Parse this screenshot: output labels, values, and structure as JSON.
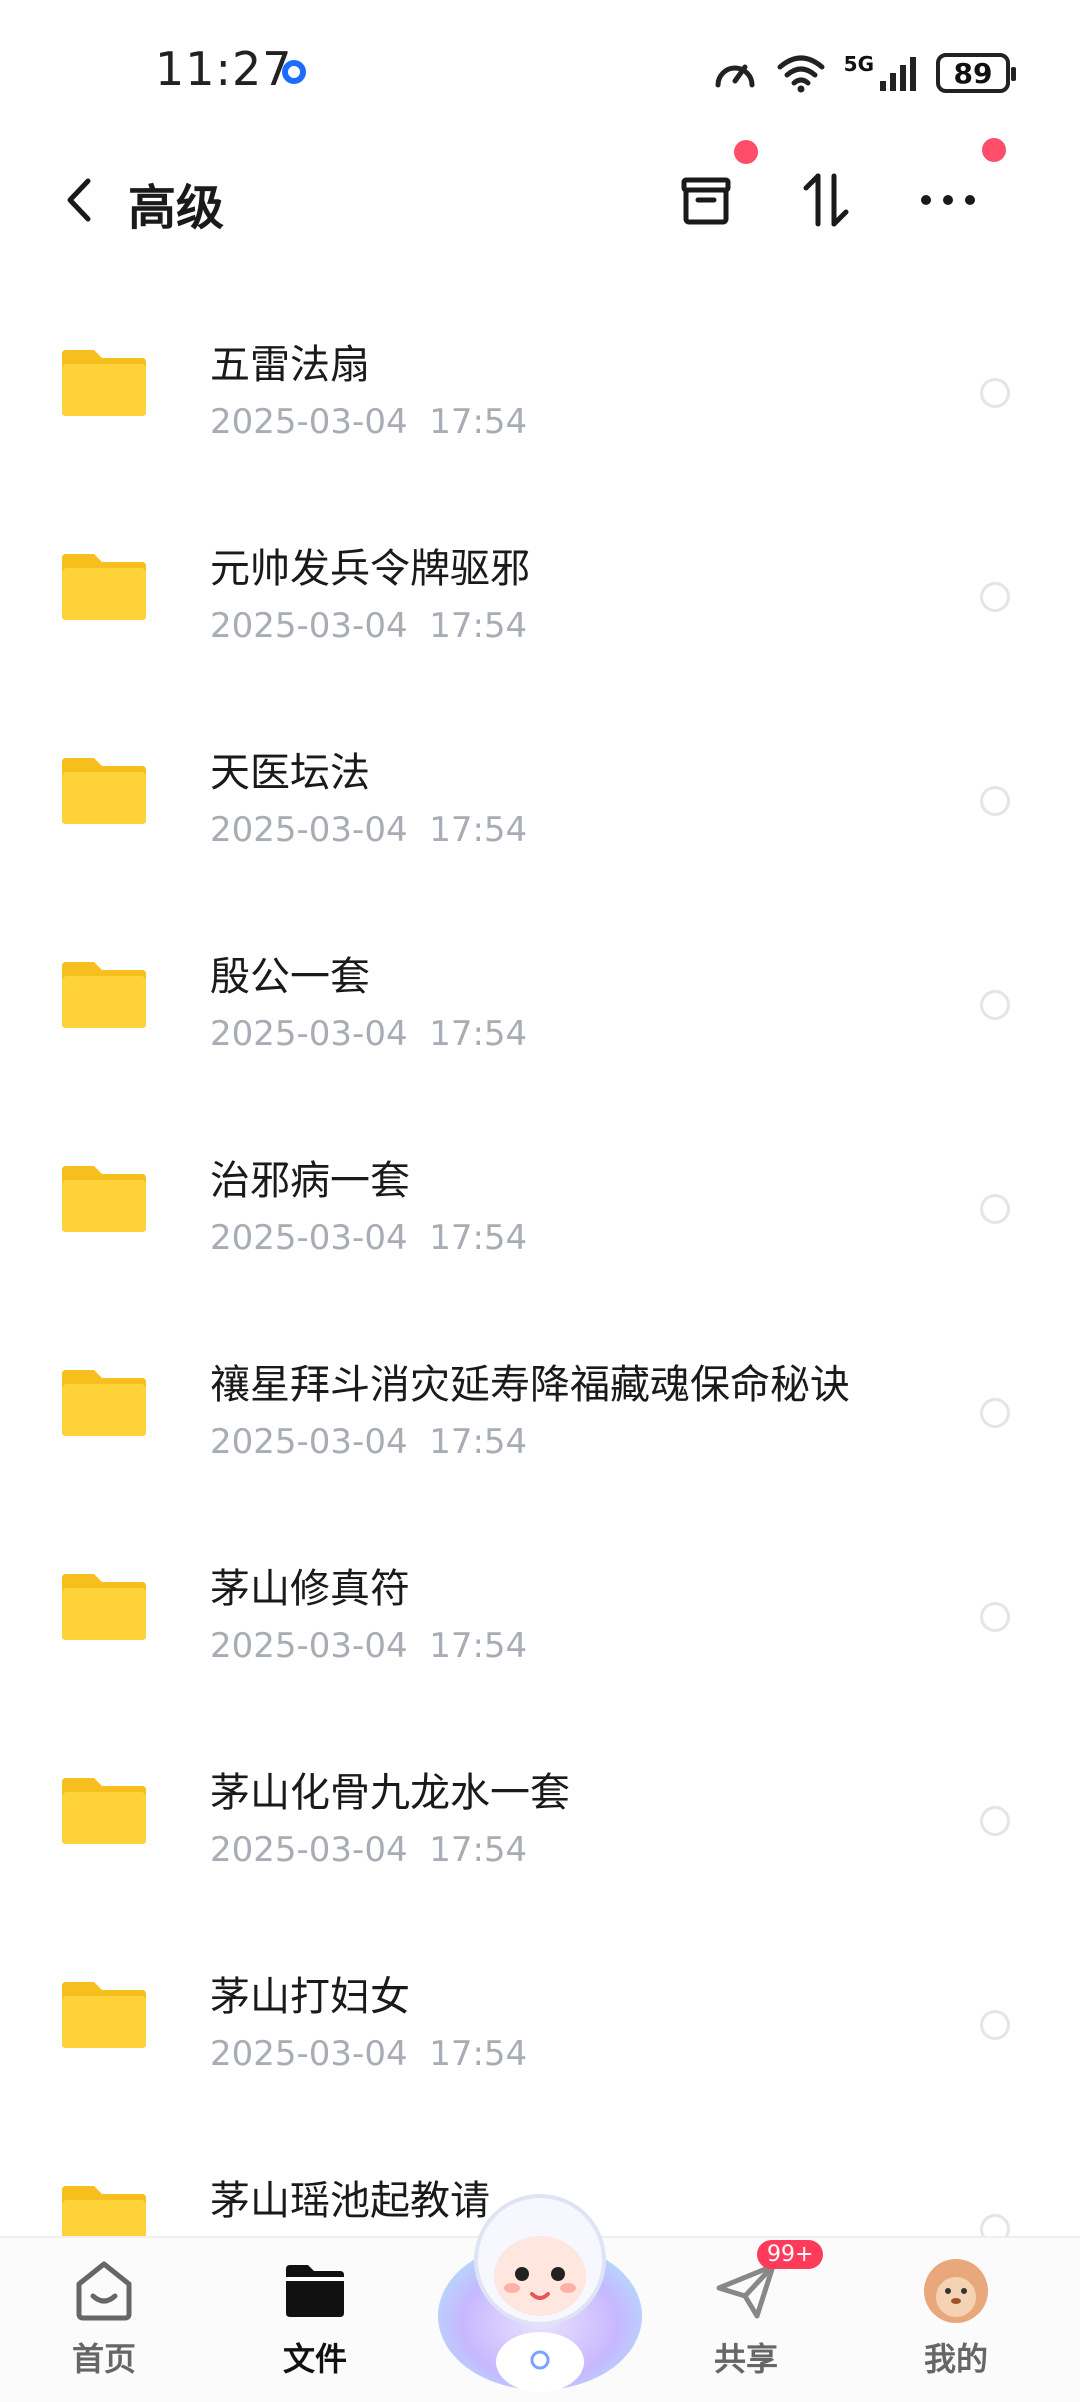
{
  "status_bar": {
    "time": "11:27",
    "network": "5G",
    "battery": "89"
  },
  "header": {
    "title": "高级"
  },
  "files": [
    {
      "name": "五雷法扇",
      "date": "2025-03-04  17:54"
    },
    {
      "name": "元帅发兵令牌驱邪",
      "date": "2025-03-04  17:54"
    },
    {
      "name": "天医坛法",
      "date": "2025-03-04  17:54"
    },
    {
      "name": "殷公一套",
      "date": "2025-03-04  17:54"
    },
    {
      "name": "治邪病一套",
      "date": "2025-03-04  17:54"
    },
    {
      "name": "禳星拜斗消灾延寿降福藏魂保命秘诀",
      "date": "2025-03-04  17:54"
    },
    {
      "name": "茅山修真符",
      "date": "2025-03-04  17:54"
    },
    {
      "name": "茅山化骨九龙水一套",
      "date": "2025-03-04  17:54"
    },
    {
      "name": "茅山打妇女",
      "date": "2025-03-04  17:54"
    },
    {
      "name": "茅山瑶池起教请",
      "date": ""
    }
  ],
  "bottom_nav": {
    "items": [
      {
        "label": "首页"
      },
      {
        "label": "文件"
      },
      {
        "label": "共享",
        "badge": "99+"
      },
      {
        "label": "我的"
      }
    ]
  },
  "colors": {
    "accent_dot": "#ff4d6a",
    "folder": "#ffd23a",
    "date_gray": "#a8acb4"
  }
}
